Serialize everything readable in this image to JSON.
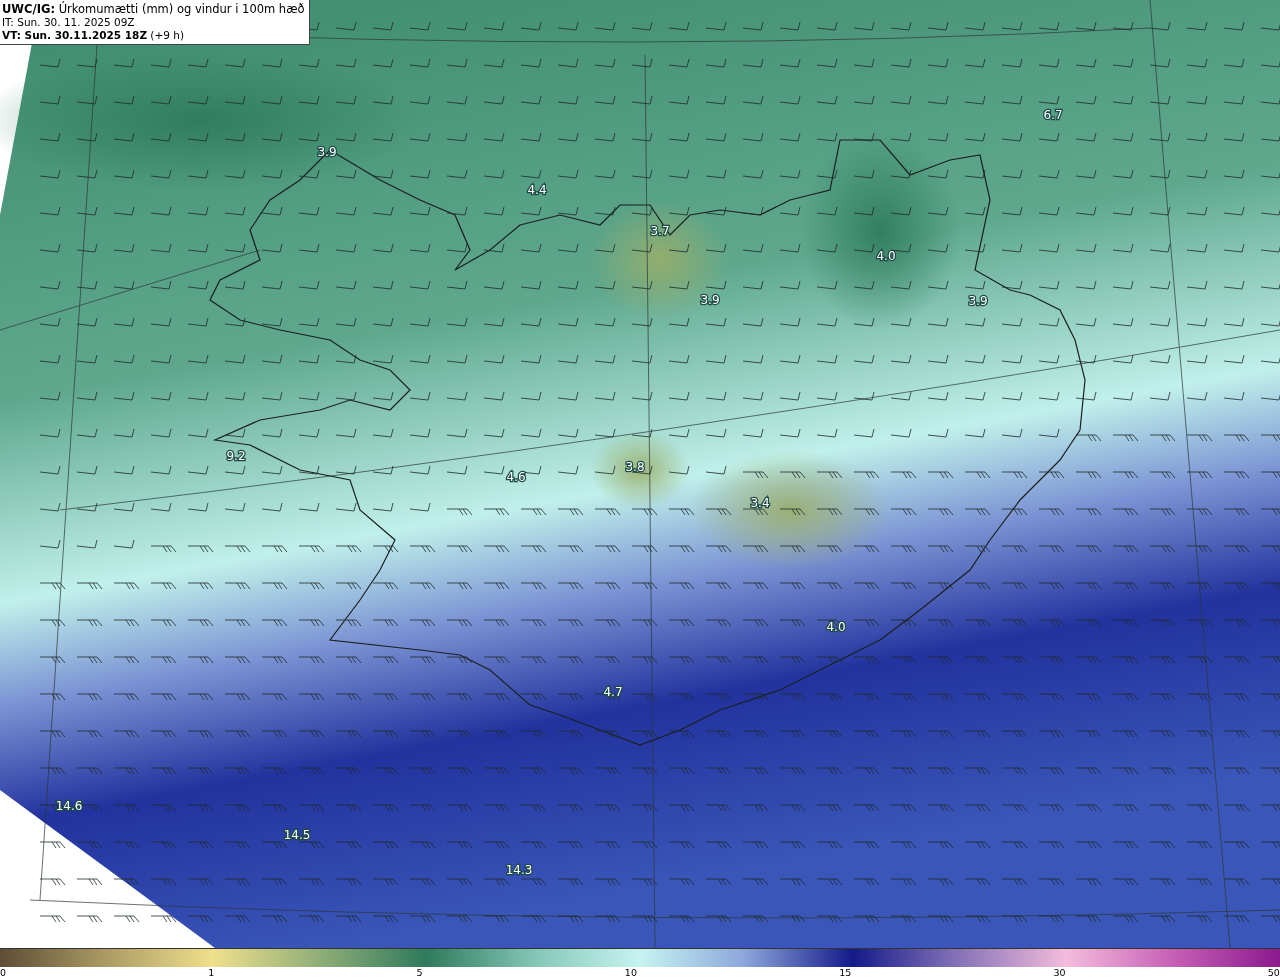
{
  "header": {
    "title": "**UWC/IG:** Úrkomumætti (mm) og vindur i 100m hæð",
    "init_time": "IT: Sun. 30. 11. 2025 09Z",
    "valid_time": "**VT: Sun. 30.11.2025 18Z** (+9 h)"
  },
  "map": {
    "value_labels": [
      "3.9",
      "4.4",
      "6.7",
      "3.7",
      "4.0",
      "3.9",
      "3.9",
      "9.2",
      "4.6",
      "3.8",
      "3.4",
      "4.0",
      "4.7",
      "14.6",
      "14.5",
      "14.3"
    ]
  },
  "color_scale": {
    "ticks": [
      "0",
      "1",
      "5",
      "10",
      "15",
      "30",
      "50"
    ]
  }
}
